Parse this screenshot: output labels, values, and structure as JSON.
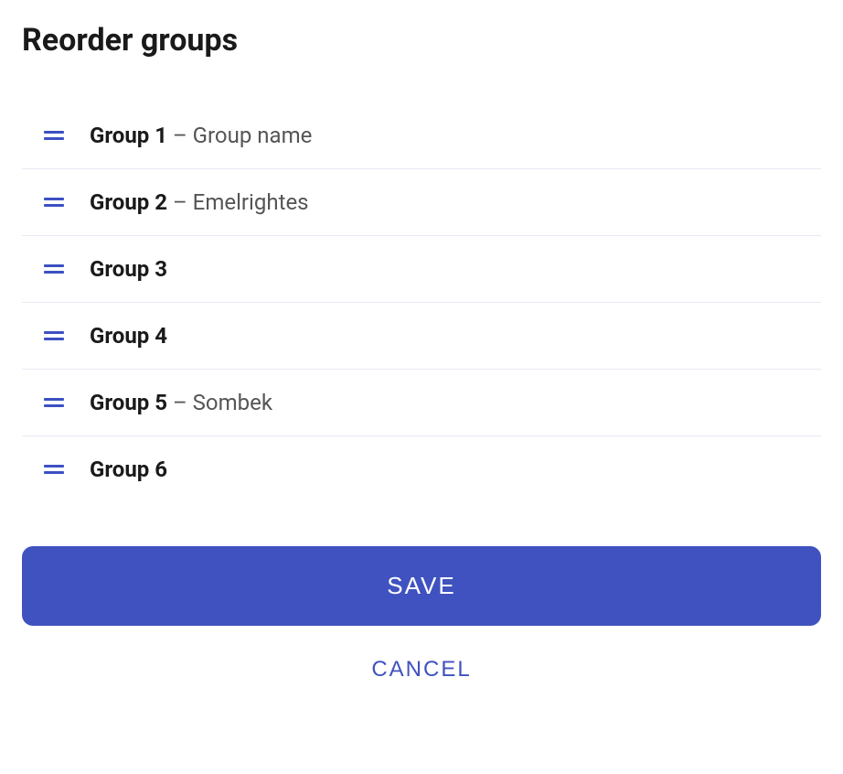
{
  "title": "Reorder groups",
  "groups": [
    {
      "label": "Group 1",
      "name": "Group name"
    },
    {
      "label": "Group 2",
      "name": "Emelrightes"
    },
    {
      "label": "Group 3",
      "name": ""
    },
    {
      "label": "Group 4",
      "name": ""
    },
    {
      "label": "Group 5",
      "name": "Sombek"
    },
    {
      "label": "Group 6",
      "name": ""
    }
  ],
  "separator": " – ",
  "actions": {
    "save_label": "SAVE",
    "cancel_label": "CANCEL"
  }
}
